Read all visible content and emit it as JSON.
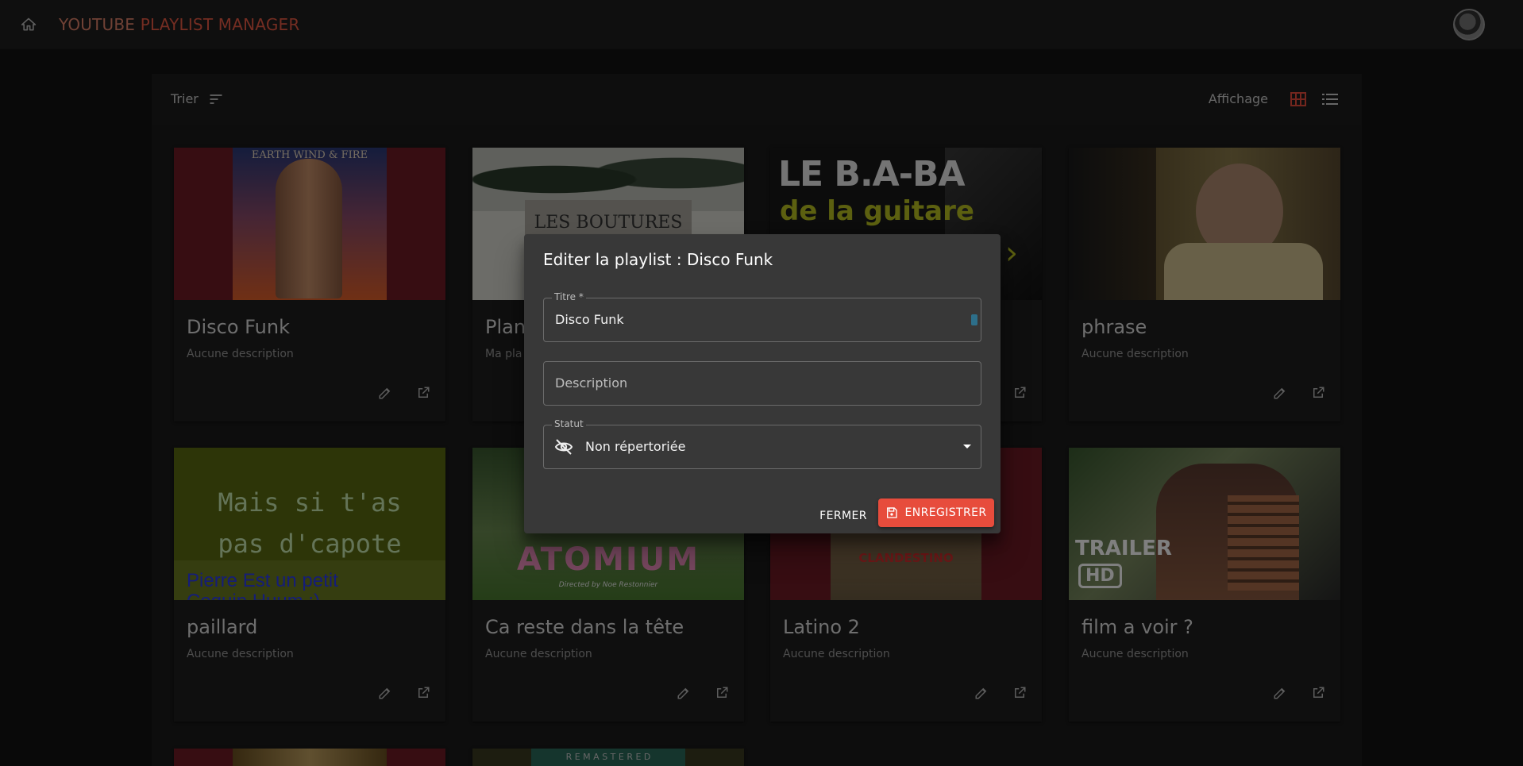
{
  "app": {
    "title_part1": "YOUTUBE ",
    "title_part2": "PLAYLIST MANAGER"
  },
  "toolbar": {
    "sort_label": "Trier",
    "view_label": "Affichage"
  },
  "cards": [
    {
      "title": "Disco Funk",
      "description": "Aucune description",
      "thumb_text": "EARTH WIND & FIRE"
    },
    {
      "title": "Plan",
      "description": "Ma pla",
      "thumb_text": "LES BOUTURES EN EAU"
    },
    {
      "title": "",
      "description": "",
      "thumb_text_1": "LE B.A-BA",
      "thumb_text_2": "de la guitare"
    },
    {
      "title": "phrase",
      "description": "Aucune description"
    },
    {
      "title": "paillard",
      "description": "Aucune description",
      "thumb_text_1": "Mais si t'as",
      "thumb_text_2": "pas d'capote",
      "thumb_text_3": "Pierre Est un petit",
      "thumb_text_4": "Coquin Huum :)"
    },
    {
      "title": "Ca reste dans la tête",
      "description": "Aucune description",
      "thumb_text_1": "ATOMIUM",
      "thumb_text_2": "Directed by Noe Restonnier"
    },
    {
      "title": "Latino 2",
      "description": "Aucune description",
      "thumb_text": "CLANDESTINO"
    },
    {
      "title": "film a voir ?",
      "description": "Aucune description",
      "thumb_text_1": "TRAILER",
      "thumb_text_2": "HD"
    },
    {
      "title": "",
      "description": ""
    },
    {
      "title": "",
      "description": "",
      "thumb_text": "R E M A S T E R E D"
    }
  ],
  "dialog": {
    "title": "Editer la playlist : Disco Funk",
    "title_field_label": "Titre *",
    "title_field_value": "Disco Funk",
    "description_placeholder": "Description",
    "status_label": "Statut",
    "status_value": "Non répertoriée",
    "close_label": "FERMER",
    "save_label": "ENREGISTRER"
  },
  "colors": {
    "accent": "#e74c3c",
    "background": "#121212",
    "card": "#1e1e1e",
    "dialog": "#383838"
  }
}
